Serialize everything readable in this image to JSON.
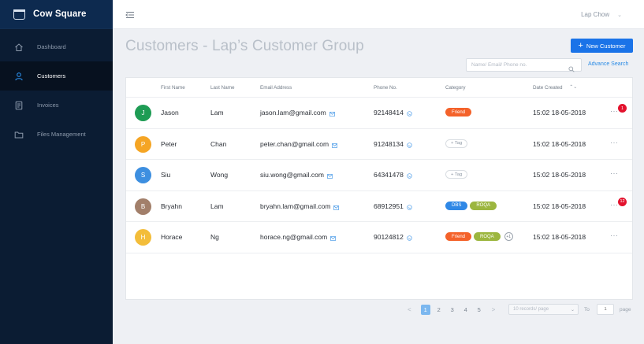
{
  "brand": {
    "name": "Cow Square"
  },
  "sidebar": {
    "items": [
      {
        "label": "Dashboard",
        "icon": "home-icon",
        "active": false
      },
      {
        "label": "Customers",
        "icon": "user-icon",
        "active": true
      },
      {
        "label": "Invoices",
        "icon": "invoice-icon",
        "active": false
      },
      {
        "label": "Files Management",
        "icon": "folder-icon",
        "active": false
      }
    ]
  },
  "header": {
    "user_name": "Lap Chow",
    "user_chevron": "⌄"
  },
  "page": {
    "title": "Customers - Lap’s Customer Group",
    "new_button_icon": "+",
    "new_button": "New Customer",
    "search_placeholder": "Name/ Email/ Phone no.",
    "advance_search": "Advance Search"
  },
  "table": {
    "headers": {
      "first_name": "First Name",
      "last_name": "Last Name",
      "email": "Email Address",
      "phone": "Phone No.",
      "category": "Category",
      "date_created": "Date Created",
      "sort_icon": "⌃⌄"
    },
    "rows": [
      {
        "initial": "J",
        "avatar_color": "#1e9c54",
        "first": "Jason",
        "last": "Lam",
        "email": "jason.lam@gmail.com",
        "phone": "92148414",
        "tags": [
          {
            "label": "Friend",
            "color": "#f4622a"
          }
        ],
        "add_tag": null,
        "extra_tags": null,
        "date": "15:02  18-05-2018",
        "more": "···",
        "badge": "1"
      },
      {
        "initial": "P",
        "avatar_color": "#f5a524",
        "first": "Peter",
        "last": "Chan",
        "email": "peter.chan@gmail.com",
        "phone": "91248134",
        "tags": [],
        "add_tag": "+ Tag",
        "extra_tags": null,
        "date": "15:02  18-05-2018",
        "more": "···",
        "badge": null
      },
      {
        "initial": "S",
        "avatar_color": "#3d8fe0",
        "first": "Siu",
        "last": "Wong",
        "email": "siu.wong@gmail.com",
        "phone": "64341478",
        "tags": [],
        "add_tag": "+ Tag",
        "extra_tags": null,
        "date": "15:02  18-05-2018",
        "more": "···",
        "badge": null
      },
      {
        "initial": "B",
        "avatar_color": "#a27f6a",
        "first": "Bryahn",
        "last": "Lam",
        "email": "bryahn.lam@gmail.com",
        "phone": "68912951",
        "tags": [
          {
            "label": "DBS",
            "color": "#2f88e6"
          },
          {
            "label": "ROQA",
            "color": "#9cb63f"
          }
        ],
        "add_tag": null,
        "extra_tags": null,
        "date": "15:02  18-05-2018",
        "more": "···",
        "badge": "12"
      },
      {
        "initial": "H",
        "avatar_color": "#f3bd3a",
        "first": "Horace",
        "last": "Ng",
        "email": "horace.ng@gmail.com",
        "phone": "90124812",
        "tags": [
          {
            "label": "Friend",
            "color": "#f4622a"
          },
          {
            "label": "ROQA",
            "color": "#9cb63f"
          }
        ],
        "add_tag": null,
        "extra_tags": "+1",
        "date": "15:02  18-05-2018",
        "more": "···",
        "badge": null
      }
    ]
  },
  "pagination": {
    "prev": "<",
    "next": ">",
    "pages": [
      "1",
      "2",
      "3",
      "4",
      "5"
    ],
    "current": "1",
    "per_page_placeholder": "10 records/ page",
    "per_page_chevron": "⌄",
    "to_label": "To",
    "page_input_placeholder": "1",
    "page_label": "page"
  },
  "colors": {
    "sidebar_bg": "#0b1c33",
    "brand_bg": "#0d2a4f",
    "accent": "#1a73e8",
    "link": "#2a8be5",
    "badge": "#e3122d"
  }
}
